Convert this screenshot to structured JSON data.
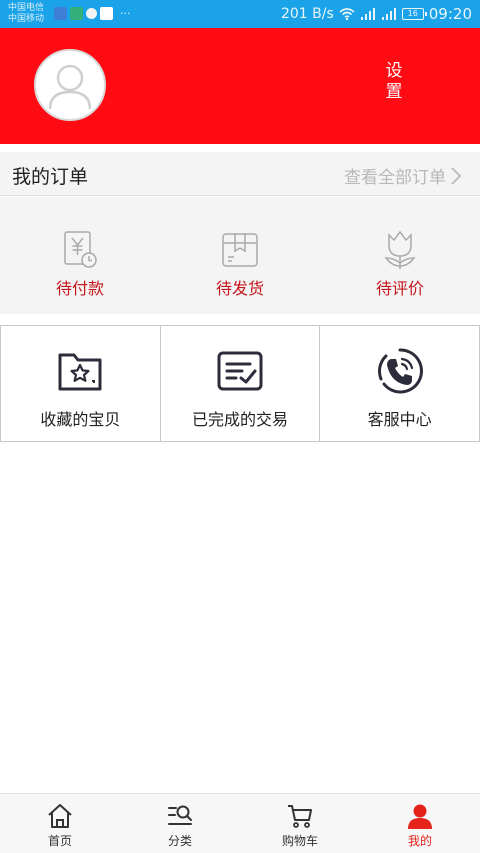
{
  "status_bar": {
    "carrier_1": "中国电信",
    "carrier_2": "中国移动",
    "more": "···",
    "net_speed": "201 B/s",
    "battery": "16",
    "time": "09:20"
  },
  "header": {
    "settings_label": "设置"
  },
  "orders": {
    "title": "我的订单",
    "view_all": "查看全部订单",
    "statuses": [
      {
        "label": "待付款",
        "icon": "yuan-clock-icon"
      },
      {
        "label": "待发货",
        "icon": "package-icon"
      },
      {
        "label": "待评价",
        "icon": "tulip-icon"
      }
    ]
  },
  "grid": [
    {
      "label": "收藏的宝贝",
      "icon": "star-folder-icon"
    },
    {
      "label": "已完成的交易",
      "icon": "completed-list-icon"
    },
    {
      "label": "客服中心",
      "icon": "phone-icon"
    }
  ],
  "bottom_nav": {
    "items": [
      {
        "label": "首页",
        "icon": "home-icon"
      },
      {
        "label": "分类",
        "icon": "category-search-icon"
      },
      {
        "label": "购物车",
        "icon": "cart-icon"
      },
      {
        "label": "我的",
        "icon": "user-icon",
        "active": true
      }
    ]
  },
  "colors": {
    "status_bar": "#1aa3e8",
    "header": "#ff0b14",
    "order_label": "#c4161c",
    "nav_active": "#e5231b"
  }
}
